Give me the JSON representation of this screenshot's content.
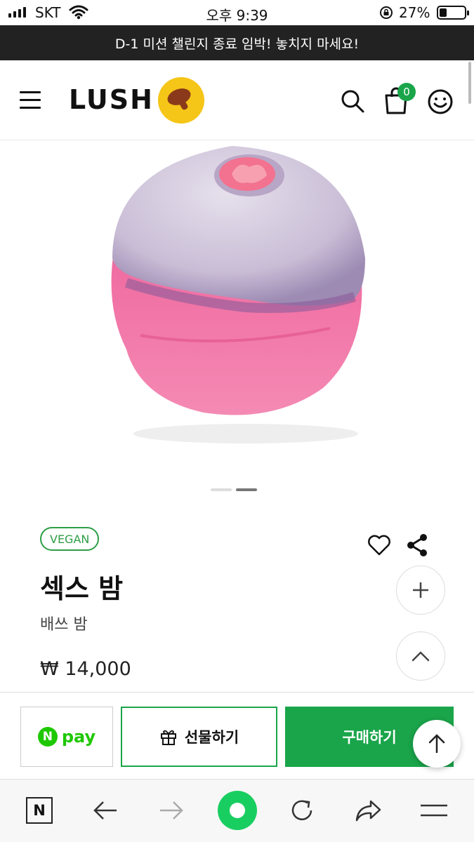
{
  "status_bar": {
    "carrier": "SKT",
    "time": "오후 9:39",
    "battery": "27%",
    "battery_level": 0.27
  },
  "banner": {
    "text": "D-1 미션 챌린지 종료 임박! 놓치지 마세요!"
  },
  "header": {
    "logo": "LUSH",
    "cart_count": "0"
  },
  "product": {
    "badge": "VEGAN",
    "title": "섹스 밤",
    "category": "배쓰 밤",
    "price": "₩ 14,000",
    "image_count": 2,
    "active_image": 2
  },
  "actions": {
    "npay_n": "N",
    "npay_label": "pay",
    "gift_label": "선물하기",
    "buy_label": "구매하기"
  },
  "toolbar": {
    "home_label": "N"
  },
  "colors": {
    "brand_green": "#1aa54a",
    "npay_green": "#1ec800",
    "banner_bg": "#222222",
    "logo_yellow": "#f5c518"
  }
}
